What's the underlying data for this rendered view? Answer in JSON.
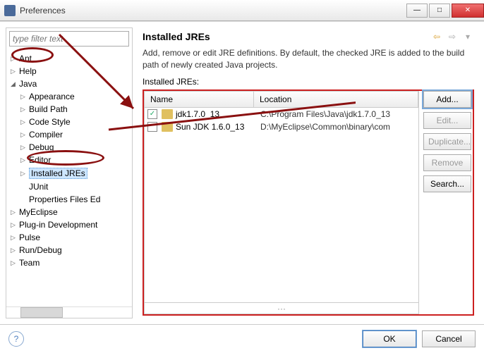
{
  "window": {
    "title": "Preferences"
  },
  "filter": {
    "placeholder": "type filter text"
  },
  "tree": {
    "items": [
      {
        "label": "Ant",
        "depth": 1,
        "arrow": "▷",
        "selected": false
      },
      {
        "label": "Help",
        "depth": 1,
        "arrow": "▷",
        "selected": false
      },
      {
        "label": "Java",
        "depth": 1,
        "arrow": "◢",
        "selected": false
      },
      {
        "label": "Appearance",
        "depth": 2,
        "arrow": "▷",
        "selected": false
      },
      {
        "label": "Build Path",
        "depth": 2,
        "arrow": "▷",
        "selected": false
      },
      {
        "label": "Code Style",
        "depth": 2,
        "arrow": "▷",
        "selected": false
      },
      {
        "label": "Compiler",
        "depth": 2,
        "arrow": "▷",
        "selected": false
      },
      {
        "label": "Debug",
        "depth": 2,
        "arrow": "▷",
        "selected": false
      },
      {
        "label": "Editor",
        "depth": 2,
        "arrow": "▷",
        "selected": false
      },
      {
        "label": "Installed JREs",
        "depth": 2,
        "arrow": "▷",
        "selected": true
      },
      {
        "label": "JUnit",
        "depth": 2,
        "arrow": "",
        "selected": false
      },
      {
        "label": "Properties Files Ed",
        "depth": 2,
        "arrow": "",
        "selected": false
      },
      {
        "label": "MyEclipse",
        "depth": 1,
        "arrow": "▷",
        "selected": false
      },
      {
        "label": "Plug-in Development",
        "depth": 1,
        "arrow": "▷",
        "selected": false
      },
      {
        "label": "Pulse",
        "depth": 1,
        "arrow": "▷",
        "selected": false
      },
      {
        "label": "Run/Debug",
        "depth": 1,
        "arrow": "▷",
        "selected": false
      },
      {
        "label": "Team",
        "depth": 1,
        "arrow": "▷",
        "selected": false
      }
    ]
  },
  "right": {
    "title": "Installed JREs",
    "description": "Add, remove or edit JRE definitions. By default, the checked JRE is added to the build path of newly created Java projects.",
    "list_label": "Installed JREs:",
    "columns": {
      "name": "Name",
      "location": "Location"
    },
    "rows": [
      {
        "checked": true,
        "name": "jdk1.7.0_13",
        "location": "C:\\Program Files\\Java\\jdk1.7.0_13"
      },
      {
        "checked": false,
        "name": "Sun JDK 1.6.0_13",
        "location": "D:\\MyEclipse\\Common\\binary\\com"
      }
    ],
    "buttons": {
      "add": "Add...",
      "edit": "Edit...",
      "duplicate": "Duplicate...",
      "remove": "Remove",
      "search": "Search..."
    }
  },
  "footer": {
    "ok": "OK",
    "cancel": "Cancel"
  }
}
